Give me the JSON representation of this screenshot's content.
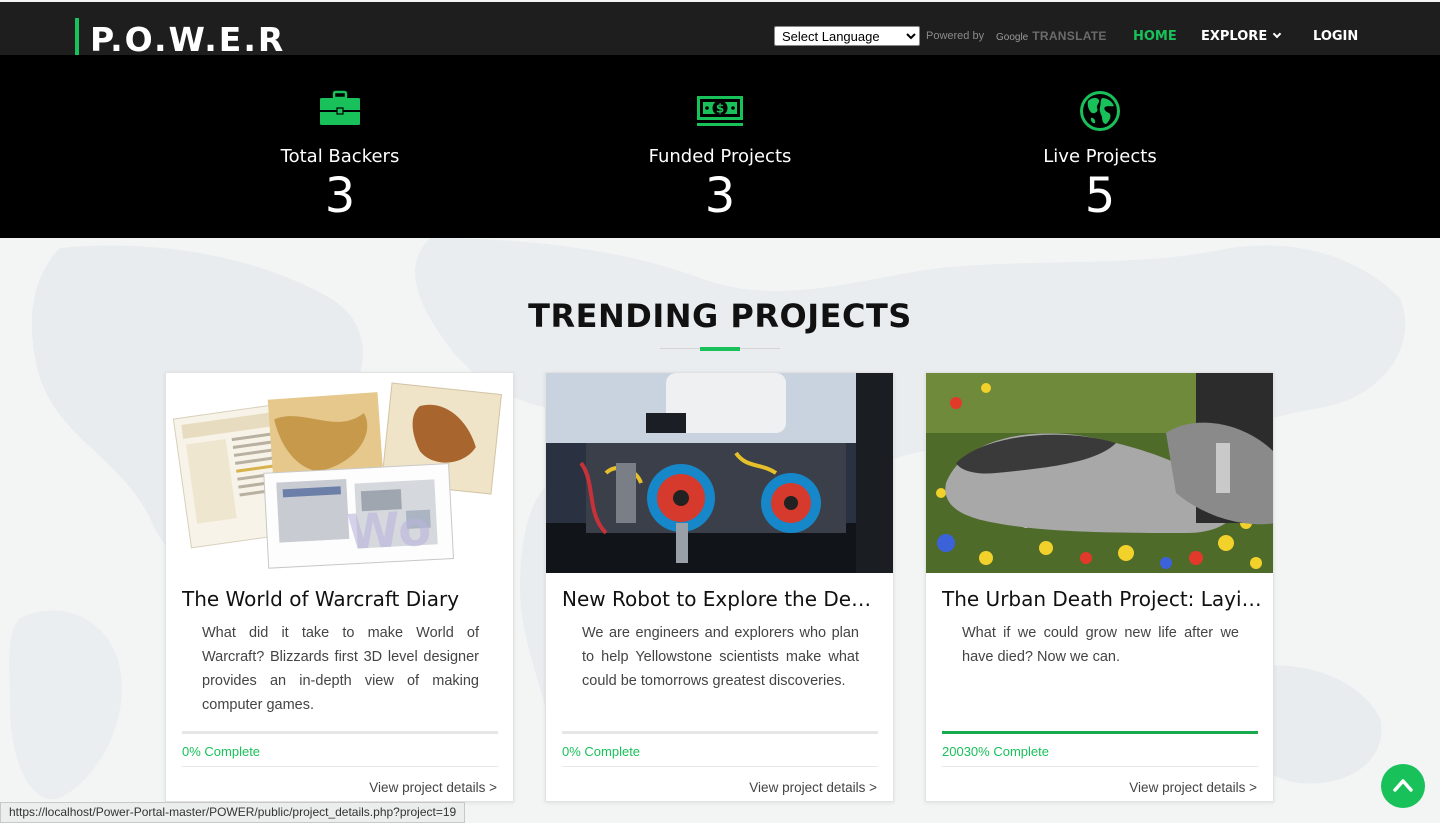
{
  "nav": {
    "brand": "P.O.W.E.R",
    "language_select": "Select Language",
    "powered_by": "Powered by",
    "google": "Google",
    "translate": "TRANSLATE",
    "home": "HOME",
    "explore": "EXPLORE",
    "login": "LOGIN"
  },
  "stats": [
    {
      "icon": "briefcase-icon",
      "label": "Total Backers",
      "value": "3"
    },
    {
      "icon": "money-icon",
      "label": "Funded Projects",
      "value": "3"
    },
    {
      "icon": "globe-icon",
      "label": "Live Projects",
      "value": "5"
    }
  ],
  "section": {
    "title": "TRENDING PROJECTS"
  },
  "projects": [
    {
      "title": "The World of Warcraft Diary",
      "description": "What did it take to make World of Warcraft? Blizzards first 3D level designer provides an in-depth view of making computer games.",
      "progress_label": "0% Complete",
      "progress": 0,
      "link": "View project details >"
    },
    {
      "title": "New Robot to Explore the Deep Waters of Yellowstone",
      "description": "We are engineers and explorers who plan to help Yellowstone scientists make what could be tomorrows greatest discoveries.",
      "progress_label": "0% Complete",
      "progress": 0,
      "link": "View project details >"
    },
    {
      "title": "The Urban Death Project: Laying the Groundwork",
      "description": "What if we could grow new life after we have died? Now we can.",
      "progress_label": "20030% Complete",
      "progress": 1,
      "link": "View project details >"
    }
  ],
  "status_url": "https://localhost/Power-Portal-master/POWER/public/project_details.php?project=19",
  "colors": {
    "accent": "#19c15a",
    "nav_bg": "#1e1e1e",
    "stats_bg": "#000000"
  }
}
